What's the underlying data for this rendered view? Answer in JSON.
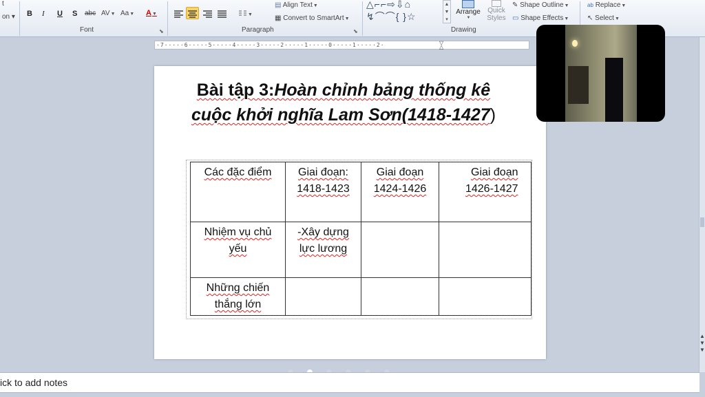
{
  "ribbon": {
    "top_left_fragment_1": "t",
    "top_left_fragment_2": "on ▾",
    "font_group": {
      "label": "Font",
      "bold": "B",
      "italic": "I",
      "underline": "U",
      "shadow": "S",
      "strikethrough": "abc",
      "char_spacing": "AV",
      "change_case": "Aa",
      "font_color": "A"
    },
    "paragraph_group": {
      "label": "Paragraph",
      "align_text": "Align Text",
      "convert_smartart": "Convert to SmartArt"
    },
    "drawing_group": {
      "label": "Drawing",
      "arrange": "Arrange",
      "quick_styles_1": "Quick",
      "quick_styles_2": "Styles",
      "shape_outline": "Shape Outline",
      "shape_effects": "Shape Effects"
    },
    "editing_group": {
      "replace": "Replace",
      "select": "Select"
    }
  },
  "ruler": {
    "ticks": "·7·····6·····5·····4·····3·····2·····1·····0·····1·····2·"
  },
  "slide": {
    "title_plain": "Bài tập 3:",
    "title_italic_1": "Hoàn chỉnh bảng thống kê",
    "title_italic_2": "cuộc khởi nghĩa Lam Sơn(1418-1427",
    "title_close": ")",
    "table": {
      "header": [
        "Các đặc điểm",
        "Giai đoạn: 1418-1423",
        "Giai đoạn 1424-1426",
        "Giai đoạn 1426-1427"
      ],
      "row1": [
        "Nhiệm vụ chủ yếu",
        "-Xây dựng lực lương",
        "",
        ""
      ],
      "row2": [
        "Những chiến thắng lớn",
        "",
        "",
        ""
      ]
    }
  },
  "notes": {
    "placeholder": "ick to add notes"
  },
  "colors": {
    "ribbon_bg": "#e3e9f2",
    "app_bg": "#c6cfdb",
    "active_align": "#f7d46a"
  }
}
